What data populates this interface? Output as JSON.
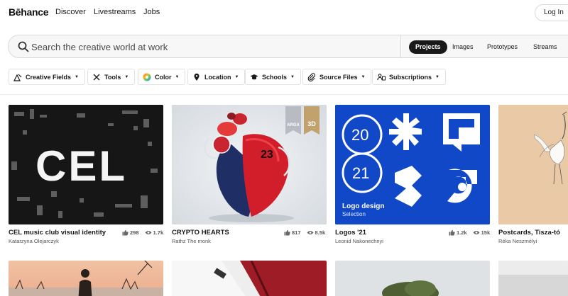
{
  "header": {
    "logo": "Bēhance",
    "nav": [
      "Discover",
      "Livestreams",
      "Jobs"
    ],
    "login": "Log In"
  },
  "search": {
    "placeholder": "Search the creative world at work",
    "scopes": [
      "Projects",
      "Images",
      "Prototypes",
      "Streams"
    ],
    "active_scope": "Projects"
  },
  "filters": [
    {
      "label": "Creative Fields",
      "icon": "creative-fields-icon"
    },
    {
      "label": "Tools",
      "icon": "tools-icon"
    },
    {
      "label": "Color",
      "icon": "color-wheel-icon"
    },
    {
      "label": "Location",
      "icon": "location-pin-icon"
    },
    {
      "label": "Schools",
      "icon": "graduation-cap-icon"
    },
    {
      "label": "Source Files",
      "icon": "paperclip-icon"
    },
    {
      "label": "Subscriptions",
      "icon": "subscriptions-icon"
    }
  ],
  "projects": [
    {
      "title": "CEL music club visual identity",
      "owner": "Katarzyna Olejarczyk",
      "likes": "298",
      "views": "1.7k",
      "cover_text": "CEL"
    },
    {
      "title": "CRYPTO HEARTS",
      "owner": "Rathz The monk",
      "likes": "817",
      "views": "8.5k",
      "cover_text": "23",
      "badges": [
        "ARGA",
        "3D"
      ]
    },
    {
      "title": "Logos '21",
      "owner": "Leonid Nakonechnyi",
      "likes": "1.2k",
      "views": "15k",
      "cover_lines": [
        "20",
        "21"
      ],
      "cover_caption": "Logo design",
      "cover_subcaption": "Selection"
    },
    {
      "title": "Postcards, Tisza-tó",
      "owner": "Réka Neszmélyi"
    }
  ],
  "colors": {
    "brand_blue": "#1148c8",
    "active_pill": "#191919",
    "tan": "#e9c9a6"
  }
}
